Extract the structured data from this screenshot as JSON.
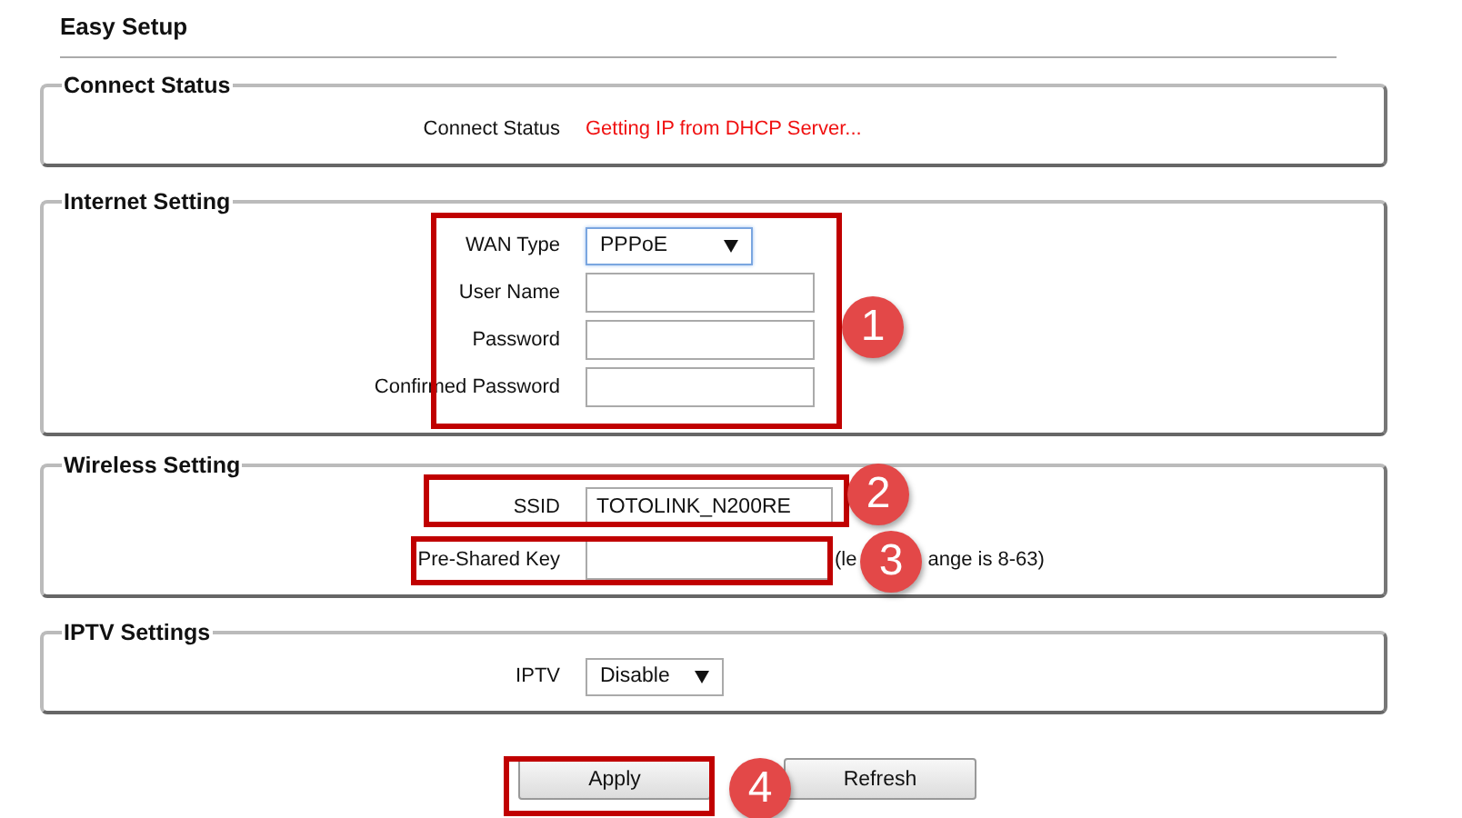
{
  "title": "Easy Setup",
  "sections": [
    {
      "legend": "Connect Status",
      "rows": [
        {
          "kind": "status",
          "label": "Connect Status",
          "value": "Getting IP from DHCP Server..."
        }
      ]
    },
    {
      "legend": "Internet Setting",
      "rows": [
        {
          "kind": "select",
          "label": "WAN Type",
          "value": "PPPoE",
          "focused": true
        },
        {
          "kind": "input",
          "label": "User Name"
        },
        {
          "kind": "input",
          "label": "Password"
        },
        {
          "kind": "input",
          "label": "Confirmed Password"
        }
      ]
    },
    {
      "legend": "Wireless Setting",
      "rows": [
        {
          "kind": "input",
          "label": "SSID",
          "value": "TOTOLINK_N200RE"
        },
        {
          "kind": "input",
          "label": "Pre-Shared Key",
          "hint_parts": [
            "(le",
            "ange is 8-63)"
          ]
        }
      ]
    },
    {
      "legend": "IPTV Settings",
      "rows": [
        {
          "kind": "select",
          "label": "IPTV",
          "value": "Disable",
          "focused": false
        }
      ]
    }
  ],
  "buttons": [
    {
      "label": "Apply"
    },
    {
      "label": "Refresh"
    }
  ],
  "annotations": [
    {
      "number": "1"
    },
    {
      "number": "2"
    },
    {
      "number": "3"
    },
    {
      "number": "4"
    }
  ]
}
